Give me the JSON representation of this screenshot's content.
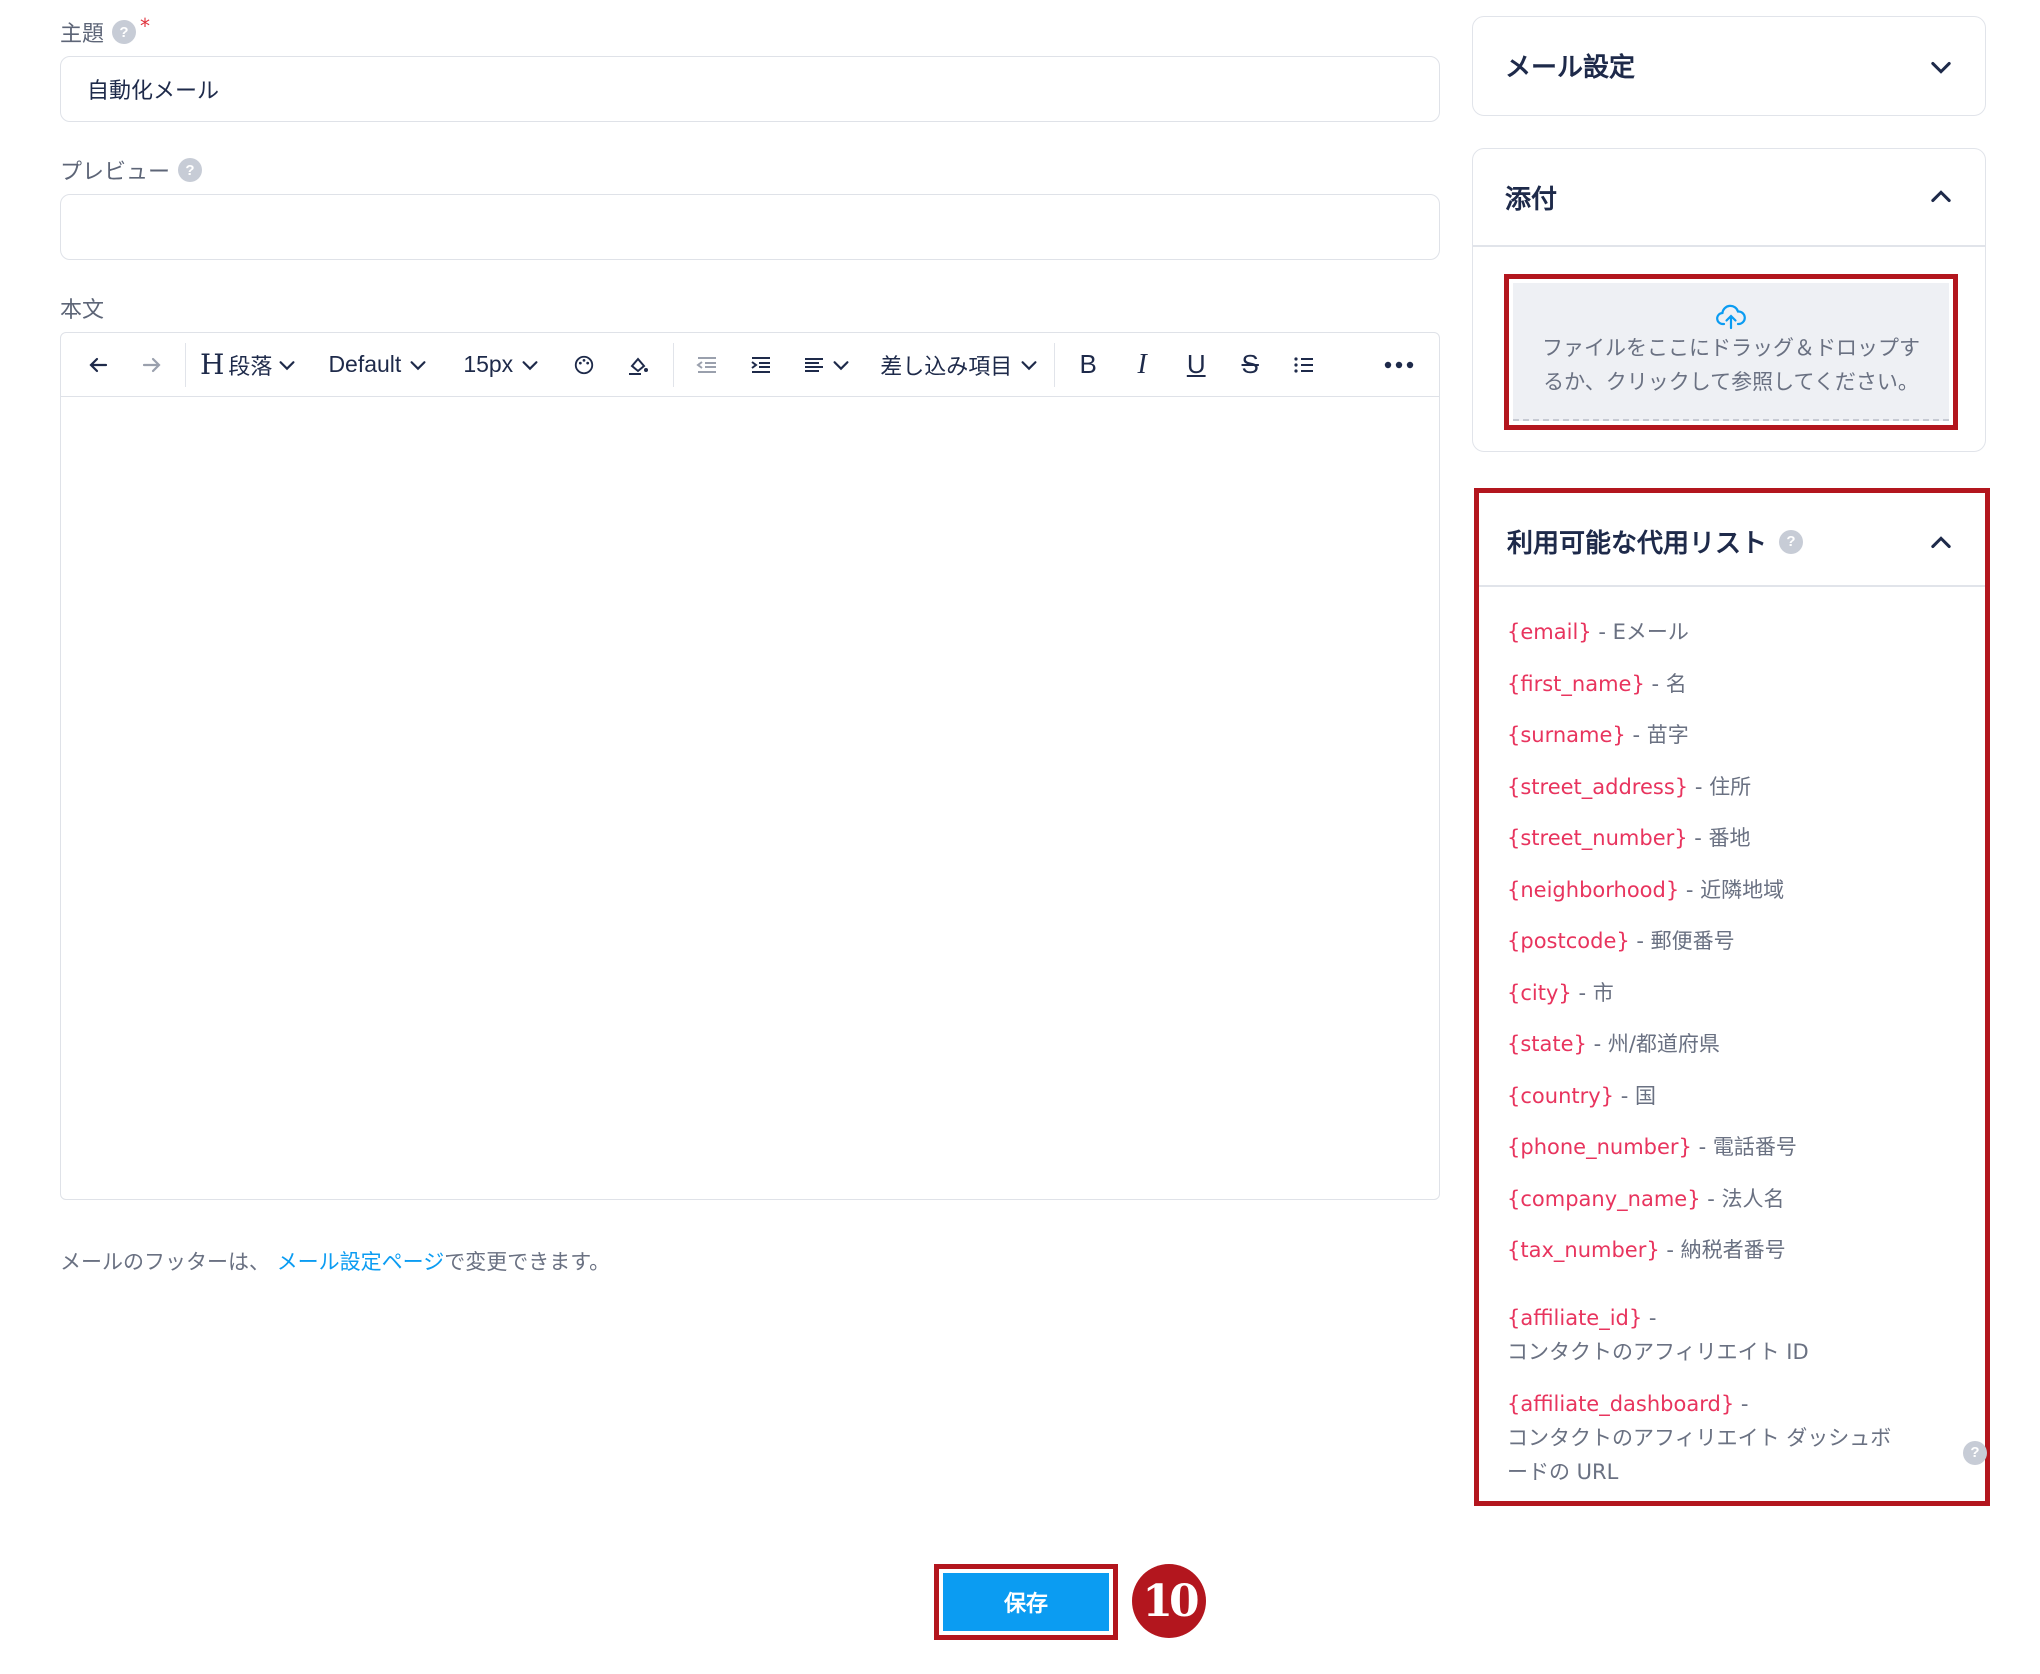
{
  "subject": {
    "label": "主題",
    "required_mark": "*",
    "help": "?",
    "value": "自動化メール"
  },
  "preview": {
    "label": "プレビュー",
    "help": "?",
    "value": ""
  },
  "body": {
    "label": "本文",
    "toolbar": {
      "heading_glyph": "H",
      "heading": "段落",
      "font": "Default",
      "size": "15px",
      "merge_fields": "差し込み項目",
      "bold": "B",
      "italic": "I",
      "underline": "U",
      "strike": "S"
    }
  },
  "footer_note": {
    "before": "メールのフッターは、",
    "link": "メール設定ページ",
    "after": "で変更できます。"
  },
  "panels": {
    "mail_settings": {
      "title": "メール設定"
    },
    "attachments": {
      "title": "添付",
      "dropzone_text_1": "ファイルをここにドラッグ＆ドロップす",
      "dropzone_text_2": "るか、クリックして参照してください。"
    },
    "substitutions": {
      "title": "利用可能な代用リスト",
      "help": "?",
      "items": [
        {
          "code": "{email}",
          "desc": " - Eメール"
        },
        {
          "code": "{first_name}",
          "desc": " - 名"
        },
        {
          "code": "{surname}",
          "desc": " - 苗字"
        },
        {
          "code": "{street_address}",
          "desc": " - 住所"
        },
        {
          "code": "{street_number}",
          "desc": " - 番地"
        },
        {
          "code": "{neighborhood}",
          "desc": " - 近隣地域"
        },
        {
          "code": "{postcode}",
          "desc": " - 郵便番号"
        },
        {
          "code": "{city}",
          "desc": " - 市"
        },
        {
          "code": "{state}",
          "desc": " - 州/都道府県"
        },
        {
          "code": "{country}",
          "desc": " - 国"
        },
        {
          "code": "{phone_number}",
          "desc": " - 電話番号"
        },
        {
          "code": "{company_name}",
          "desc": " - 法人名"
        },
        {
          "code": "{tax_number}",
          "desc": " - 納税者番号"
        }
      ],
      "affiliate_id": {
        "code": "{affiliate_id}",
        "dash": " -",
        "desc": "コンタクトのアフィリエイト ID"
      },
      "affiliate_dashboard": {
        "code": "{affiliate_dashboard}",
        "dash": " -",
        "desc_1": "コンタクトのアフィリエイト ダッシュボ",
        "desc_2": "ードの URL"
      }
    }
  },
  "save_button": "保存",
  "step_badge": "10",
  "colors": {
    "accent": "#0b9cf2",
    "highlight": "#b3161e",
    "code": "#e8345e",
    "text": "#1e2a4a"
  }
}
